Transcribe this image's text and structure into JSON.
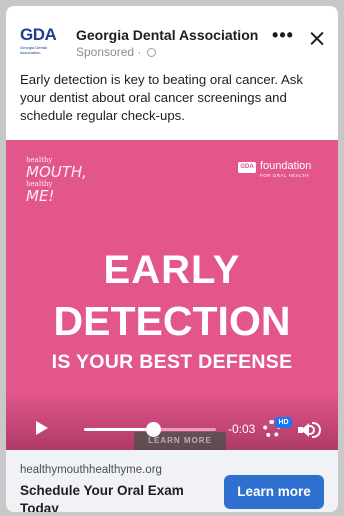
{
  "header": {
    "logo_text": "GDA",
    "logo_subtext": "Georgia Dental Association",
    "page_name": "Georgia Dental Association",
    "sponsored_label": "Sponsored ·",
    "more_icon": "more-horizontal-icon",
    "close_icon": "close-icon"
  },
  "post": {
    "caption": "Early detection is key to beating oral cancer. Ask your dentist about oral cancer screenings and schedule regular check-ups."
  },
  "media": {
    "background_color": "#e2568c",
    "campaign_logo_line1": "healthy",
    "campaign_logo_line2": "MOUTH,",
    "campaign_logo_line3": "healthy",
    "campaign_logo_line4": "ME!",
    "foundation_badge": "GDA",
    "foundation_name": "foundation",
    "foundation_sub": "FOR ORAL HEALTH",
    "headline_line1": "EARLY",
    "headline_line2": "DETECTION",
    "headline_line3": "IS YOUR BEST DEFENSE"
  },
  "video_controls": {
    "play_icon": "play-icon",
    "progress_fraction": 0.5,
    "overlay_button_label": "LEARN MORE",
    "time_remaining": "-0:03",
    "settings_icon": "gear-icon",
    "quality_badge": "HD",
    "volume_icon": "speaker-icon"
  },
  "footer": {
    "domain": "healthymouthhealthyme.org",
    "cta_title": "Schedule Your Oral Exam Today",
    "button_label": "Learn more",
    "button_color": "#2f6fcf"
  }
}
